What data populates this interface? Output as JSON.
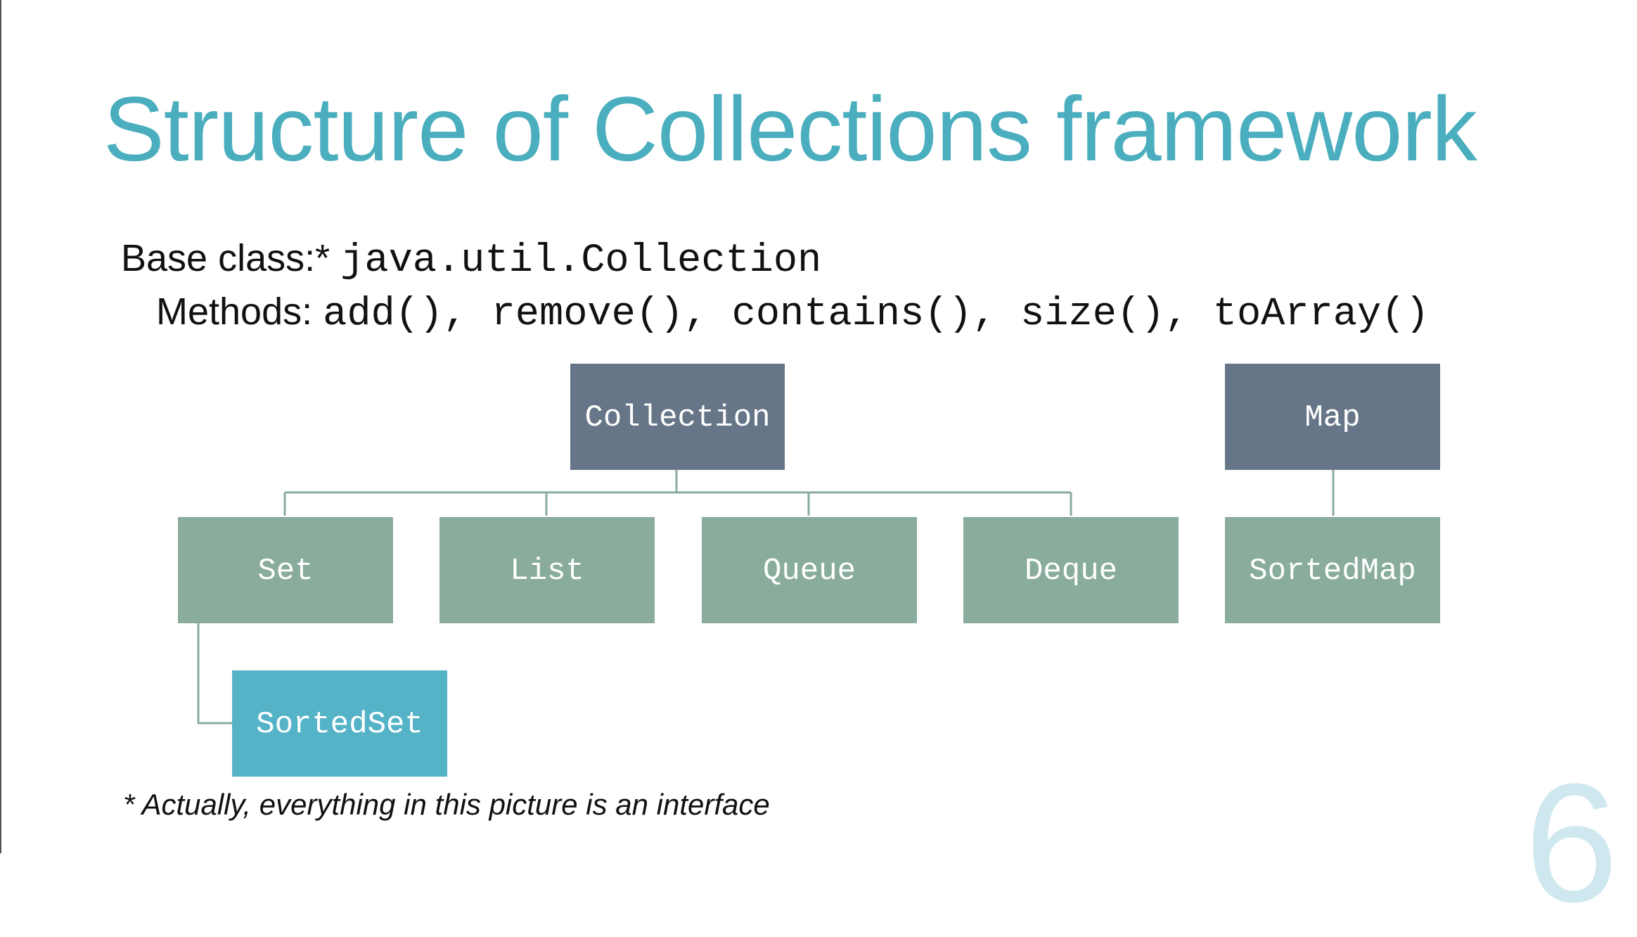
{
  "title": "Structure of Collections framework",
  "base_class": {
    "label": "Base class:*",
    "value": "java.util.Collection"
  },
  "methods": {
    "label": "Methods:",
    "list": "add(), remove(), contains(), size(), toArray()"
  },
  "diagram": {
    "nodes": {
      "collection": "Collection",
      "map": "Map",
      "set": "Set",
      "list": "List",
      "queue": "Queue",
      "deque": "Deque",
      "sorted_map": "SortedMap",
      "sorted_set": "SortedSet"
    },
    "colors": {
      "root": "#667587",
      "child": "#89ac9c",
      "grandchild": "#55b3c8",
      "connector": "#89ac9c"
    }
  },
  "footnote": "* Actually, everything in this picture is an interface",
  "slide_number": "6",
  "colors": {
    "title": "#4aaebf",
    "text": "#111111"
  }
}
